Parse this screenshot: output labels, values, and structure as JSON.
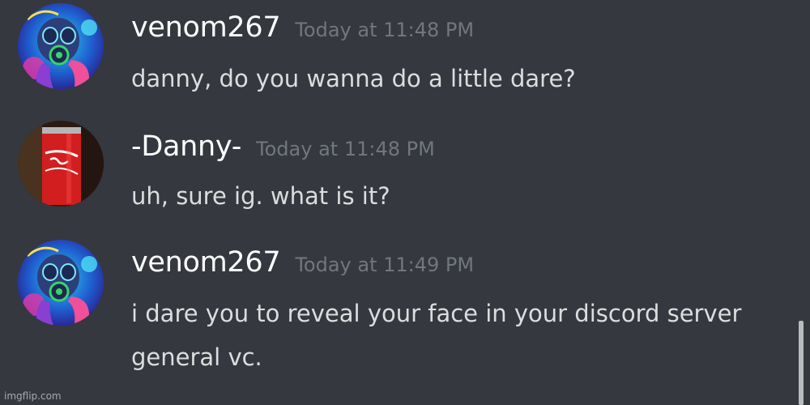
{
  "messages": [
    {
      "username": "venom267",
      "timestamp": "Today at 11:48 PM",
      "avatar_icon": "gas-mask-character-icon",
      "lines": [
        "danny, do you wanna do a little dare?"
      ]
    },
    {
      "username": "-Danny-",
      "timestamp": "Today at 11:48 PM",
      "avatar_icon": "coca-cola-can-icon",
      "lines": [
        "uh, sure ig. what is it?"
      ]
    },
    {
      "username": "venom267",
      "timestamp": "Today at 11:49 PM",
      "avatar_icon": "gas-mask-character-icon",
      "lines": [
        "i dare you to reveal your face in your discord server",
        "general vc."
      ]
    }
  ],
  "watermark": "imgflip.com",
  "colors": {
    "background": "#35383e",
    "username": "#ffffff",
    "timestamp": "#72767d",
    "message_text": "#dcddde"
  }
}
